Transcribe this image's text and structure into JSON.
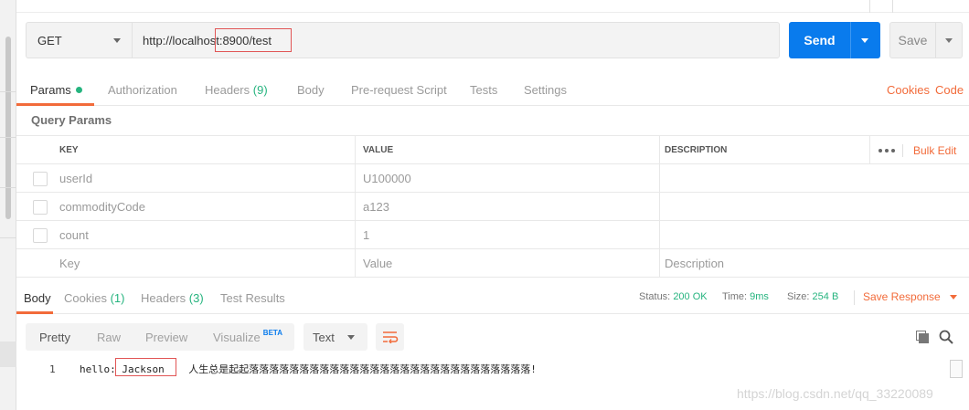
{
  "request": {
    "method": "GET",
    "url": "http://localhost:8900/test",
    "send_label": "Send",
    "save_label": "Save"
  },
  "request_tabs": {
    "params": "Params",
    "authorization": "Authorization",
    "headers": "Headers",
    "headers_count": "(9)",
    "body": "Body",
    "pre_request_script": "Pre-request Script",
    "tests": "Tests",
    "settings": "Settings",
    "cookies": "Cookies",
    "code": "Code"
  },
  "query_params": {
    "title": "Query Params",
    "columns": {
      "key": "KEY",
      "value": "VALUE",
      "description": "DESCRIPTION"
    },
    "bulk_edit": "Bulk Edit",
    "rows": [
      {
        "key": "userId",
        "value": "U100000",
        "description": ""
      },
      {
        "key": "commodityCode",
        "value": "a123",
        "description": ""
      },
      {
        "key": "count",
        "value": "1",
        "description": ""
      }
    ],
    "placeholder": {
      "key": "Key",
      "value": "Value",
      "description": "Description"
    }
  },
  "response": {
    "tabs": {
      "body": "Body",
      "cookies": "Cookies",
      "cookies_count": "(1)",
      "headers": "Headers",
      "headers_count": "(3)",
      "test_results": "Test Results"
    },
    "status_label": "Status:",
    "status_value": "200 OK",
    "time_label": "Time:",
    "time_value": "9ms",
    "size_label": "Size:",
    "size_value": "254 B",
    "save_response": "Save Response",
    "views": {
      "pretty": "Pretty",
      "raw": "Raw",
      "preview": "Preview",
      "visualize": "Visualize",
      "beta": "BETA"
    },
    "format": "Text",
    "line_number": "1",
    "body_text": "hello: Jackson    人生总是起起落落落落落落落落落落落落落落落落落落落落落落落落落落落落!"
  },
  "watermark": "https://blog.csdn.net/qq_33220089",
  "colors": {
    "accent": "#f26b3a",
    "send_blue": "#097bed",
    "success_green": "#26b47f",
    "highlight_red": "#e15555"
  }
}
